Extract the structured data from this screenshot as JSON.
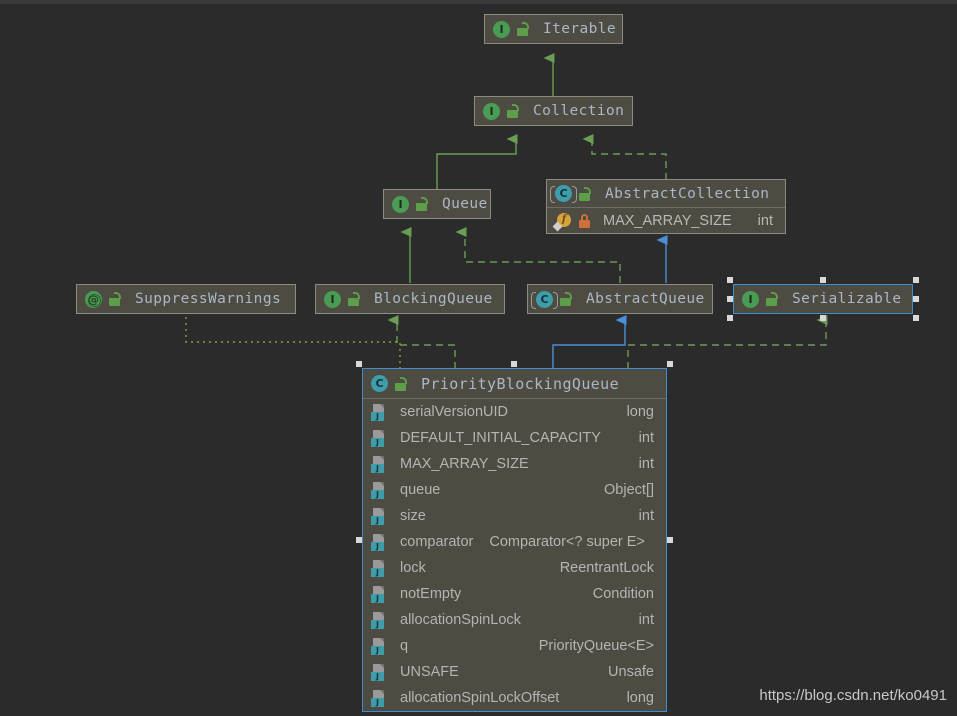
{
  "canvas": {
    "background": "#2b2b2b",
    "node_fill": "#4e4b42",
    "node_border": "#8c8b84",
    "selection_color": "#3d8fd1",
    "title_color": "#a9b7c6",
    "member_color": "#b4b4b4",
    "inherit_edge_color": "#6a9e54",
    "blue_edge_color": "#4a90d9",
    "dependency_edge_color": "#9a9a3c"
  },
  "watermark": "https://blog.csdn.net/ko0491",
  "nodes": [
    {
      "id": "iterable",
      "title": "Iterable",
      "kind": "interface",
      "icon": "interface-icon",
      "visibility": "public",
      "visibility_icon": "lock-open-icon",
      "selected": false,
      "members": []
    },
    {
      "id": "collection",
      "title": "Collection",
      "kind": "interface",
      "icon": "interface-icon",
      "visibility": "public",
      "visibility_icon": "lock-open-icon",
      "selected": false,
      "members": []
    },
    {
      "id": "queue",
      "title": "Queue",
      "kind": "interface",
      "icon": "interface-icon",
      "visibility": "public",
      "visibility_icon": "lock-open-icon",
      "selected": false,
      "members": []
    },
    {
      "id": "abstract-collection",
      "title": "AbstractCollection",
      "kind": "abstract-class",
      "icon": "abstract-class-icon",
      "visibility": "public",
      "visibility_icon": "lock-open-icon",
      "selected": false,
      "members": [
        {
          "name": "MAX_ARRAY_SIZE",
          "type": "int",
          "icon": "field-f-icon",
          "visibility": "private",
          "visibility_icon": "lock-closed-icon"
        }
      ]
    },
    {
      "id": "suppress-warnings",
      "title": "SuppressWarnings",
      "kind": "annotation",
      "icon": "annotation-icon",
      "visibility": "public",
      "visibility_icon": "lock-open-icon",
      "selected": false,
      "members": []
    },
    {
      "id": "blocking-queue",
      "title": "BlockingQueue",
      "kind": "interface",
      "icon": "interface-icon",
      "visibility": "public",
      "visibility_icon": "lock-open-icon",
      "selected": false,
      "members": []
    },
    {
      "id": "abstract-queue",
      "title": "AbstractQueue",
      "kind": "abstract-class",
      "icon": "abstract-class-icon",
      "visibility": "public",
      "visibility_icon": "lock-open-icon",
      "selected": false,
      "members": []
    },
    {
      "id": "serializable",
      "title": "Serializable",
      "kind": "interface",
      "icon": "interface-icon",
      "visibility": "public",
      "visibility_icon": "lock-open-icon",
      "selected": true,
      "members": []
    },
    {
      "id": "priority-blocking-queue",
      "title": "PriorityBlockingQueue",
      "kind": "class",
      "icon": "class-icon",
      "visibility": "public",
      "visibility_icon": "lock-open-icon",
      "selected": true,
      "members": [
        {
          "name": "serialVersionUID",
          "type": "long",
          "icon": "field-icon"
        },
        {
          "name": "DEFAULT_INITIAL_CAPACITY",
          "type": "int",
          "icon": "field-icon"
        },
        {
          "name": "MAX_ARRAY_SIZE",
          "type": "int",
          "icon": "field-icon"
        },
        {
          "name": "queue",
          "type": "Object[]",
          "icon": "field-icon"
        },
        {
          "name": "size",
          "type": "int",
          "icon": "field-icon"
        },
        {
          "name": "comparator",
          "type": "Comparator<? super E>",
          "icon": "field-icon"
        },
        {
          "name": "lock",
          "type": "ReentrantLock",
          "icon": "field-icon"
        },
        {
          "name": "notEmpty",
          "type": "Condition",
          "icon": "field-icon"
        },
        {
          "name": "allocationSpinLock",
          "type": "int",
          "icon": "field-icon"
        },
        {
          "name": "q",
          "type": "PriorityQueue<E>",
          "icon": "field-icon"
        },
        {
          "name": "UNSAFE",
          "type": "Unsafe",
          "icon": "field-icon"
        },
        {
          "name": "allocationSpinLockOffset",
          "type": "long",
          "icon": "field-icon"
        }
      ]
    }
  ],
  "edges": [
    {
      "from": "collection",
      "to": "iterable",
      "style": "solid",
      "color": "#6a9e54",
      "arrow": "triangle"
    },
    {
      "from": "queue",
      "to": "collection",
      "style": "solid",
      "color": "#6a9e54",
      "arrow": "triangle"
    },
    {
      "from": "abstract-collection",
      "to": "collection",
      "style": "dashed",
      "color": "#6a9e54",
      "arrow": "triangle"
    },
    {
      "from": "blocking-queue",
      "to": "queue",
      "style": "solid",
      "color": "#6a9e54",
      "arrow": "triangle"
    },
    {
      "from": "abstract-queue",
      "to": "queue",
      "style": "dashed",
      "color": "#6a9e54",
      "arrow": "triangle"
    },
    {
      "from": "abstract-queue",
      "to": "abstract-collection",
      "style": "solid",
      "color": "#4a90d9",
      "arrow": "triangle"
    },
    {
      "from": "priority-blocking-queue",
      "to": "blocking-queue",
      "style": "dashed",
      "color": "#6a9e54",
      "arrow": "triangle"
    },
    {
      "from": "priority-blocking-queue",
      "to": "abstract-queue",
      "style": "solid",
      "color": "#4a90d9",
      "arrow": "triangle"
    },
    {
      "from": "priority-blocking-queue",
      "to": "serializable",
      "style": "dashed",
      "color": "#6a9e54",
      "arrow": "triangle"
    },
    {
      "from": "priority-blocking-queue",
      "to": "suppress-warnings",
      "style": "dotted",
      "color": "#9a9a3c",
      "arrow": "none"
    }
  ]
}
